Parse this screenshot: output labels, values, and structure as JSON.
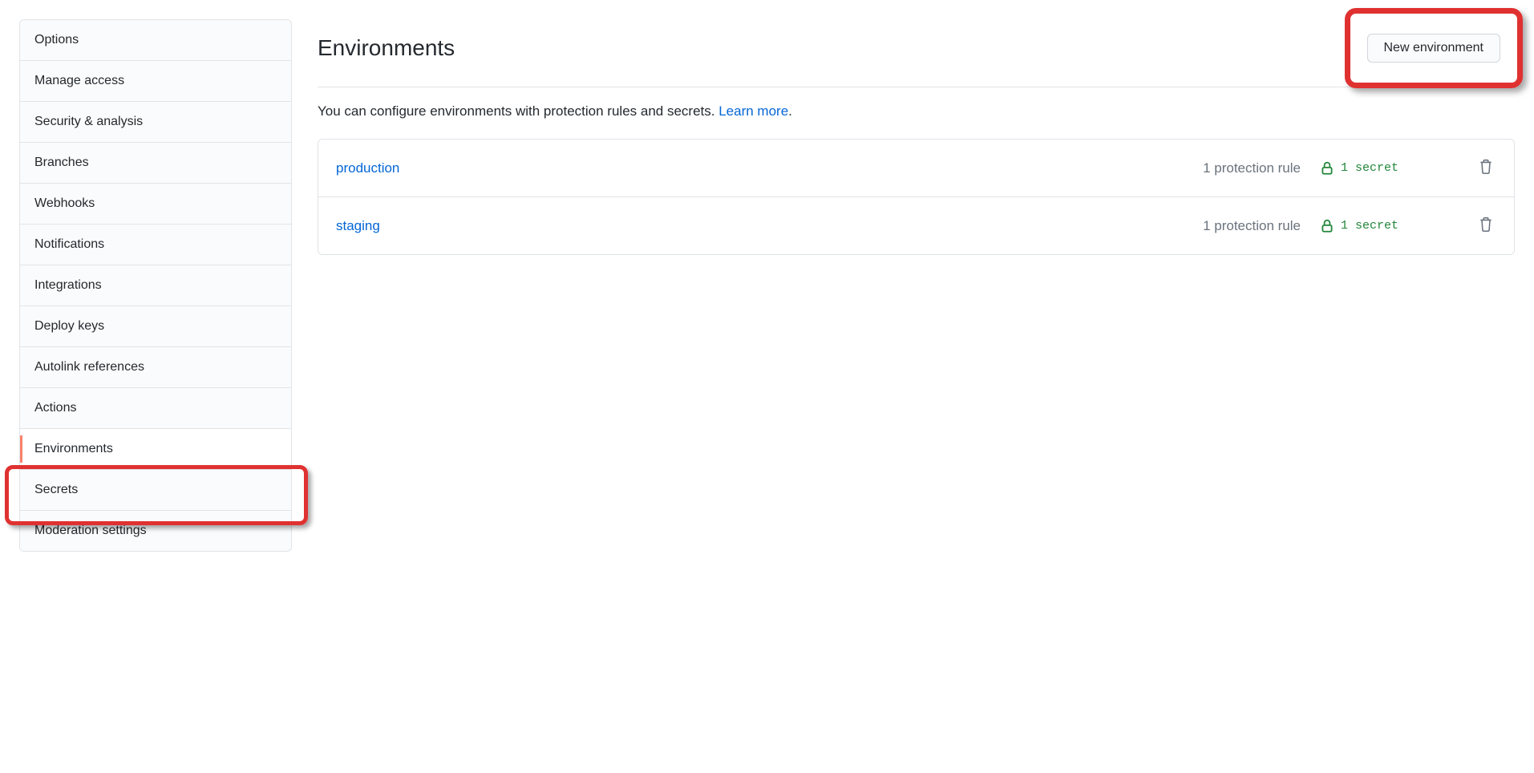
{
  "sidebar": {
    "items": [
      {
        "label": "Options",
        "active": false
      },
      {
        "label": "Manage access",
        "active": false
      },
      {
        "label": "Security & analysis",
        "active": false
      },
      {
        "label": "Branches",
        "active": false
      },
      {
        "label": "Webhooks",
        "active": false
      },
      {
        "label": "Notifications",
        "active": false
      },
      {
        "label": "Integrations",
        "active": false
      },
      {
        "label": "Deploy keys",
        "active": false
      },
      {
        "label": "Autolink references",
        "active": false
      },
      {
        "label": "Actions",
        "active": false
      },
      {
        "label": "Environments",
        "active": true
      },
      {
        "label": "Secrets",
        "active": false
      },
      {
        "label": "Moderation settings",
        "active": false
      }
    ]
  },
  "header": {
    "title": "Environments",
    "new_button": "New environment"
  },
  "description": {
    "text": "You can configure environments with protection rules and secrets. ",
    "link_text": "Learn more",
    "suffix": "."
  },
  "environments": [
    {
      "name": "production",
      "protection": "1 protection rule",
      "secret": "1 secret"
    },
    {
      "name": "staging",
      "protection": "1 protection rule",
      "secret": "1 secret"
    }
  ]
}
